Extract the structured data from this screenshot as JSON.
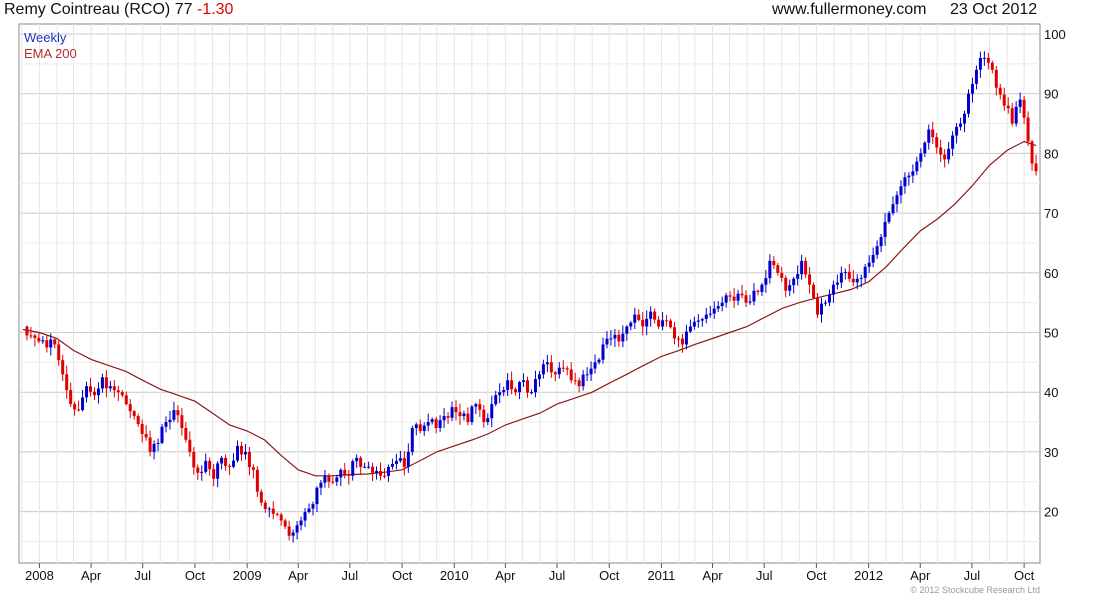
{
  "header": {
    "company": "Remy Cointreau (RCO)",
    "price": "77",
    "change": "-1.30",
    "site": "www.fullermoney.com",
    "date": "23 Oct 2012"
  },
  "legend": [
    "Weekly",
    "EMA 200"
  ],
  "footer": "© 2012 Stockcube Research Ltd",
  "colors": {
    "up": "#0000cc",
    "down": "#e00000",
    "ema": "#8b1a1a",
    "grid": "#c8c8c8",
    "legend_weekly": "#2233bb",
    "legend_ema": "#b03030"
  },
  "chart_data": {
    "type": "candlestick",
    "x_ticks": [
      "2008",
      "Apr",
      "Jul",
      "Oct",
      "2009",
      "Apr",
      "Jul",
      "Oct",
      "2010",
      "Apr",
      "Jul",
      "Oct",
      "2011",
      "Apr",
      "Jul",
      "Oct",
      "2012",
      "Apr",
      "Jul",
      "Oct"
    ],
    "y_ticks": [
      20,
      30,
      40,
      50,
      60,
      70,
      80,
      90,
      100
    ],
    "ylim": [
      14,
      101
    ],
    "close_series": [
      [
        "2007-12-03",
        51
      ],
      [
        "2007-12-17",
        49.5
      ],
      [
        "2007-12-31",
        48.5
      ],
      [
        "2008-01-14",
        47.5
      ],
      [
        "2008-01-28",
        48
      ],
      [
        "2008-02-11",
        43
      ],
      [
        "2008-02-25",
        38
      ],
      [
        "2008-03-10",
        37
      ],
      [
        "2008-03-24",
        41
      ],
      [
        "2008-04-07",
        39.5
      ],
      [
        "2008-04-21",
        42.5
      ],
      [
        "2008-05-05",
        41
      ],
      [
        "2008-05-19",
        40
      ],
      [
        "2008-06-02",
        38
      ],
      [
        "2008-06-16",
        36
      ],
      [
        "2008-06-30",
        33
      ],
      [
        "2008-07-14",
        30
      ],
      [
        "2008-07-28",
        31.5
      ],
      [
        "2008-08-11",
        35
      ],
      [
        "2008-08-25",
        37
      ],
      [
        "2008-09-08",
        34
      ],
      [
        "2008-09-22",
        30
      ],
      [
        "2008-10-06",
        26.5
      ],
      [
        "2008-10-20",
        28.5
      ],
      [
        "2008-11-03",
        25.5
      ],
      [
        "2008-11-17",
        29
      ],
      [
        "2008-12-01",
        27.5
      ],
      [
        "2008-12-15",
        31
      ],
      [
        "2008-12-29",
        30
      ],
      [
        "2009-01-12",
        27
      ],
      [
        "2009-01-26",
        21.5
      ],
      [
        "2009-02-09",
        20.5
      ],
      [
        "2009-02-23",
        19.5
      ],
      [
        "2009-03-09",
        17.5
      ],
      [
        "2009-03-23",
        16.5
      ],
      [
        "2009-04-06",
        18.5
      ],
      [
        "2009-04-20",
        20.5
      ],
      [
        "2009-05-04",
        24
      ],
      [
        "2009-05-18",
        26
      ],
      [
        "2009-06-01",
        25
      ],
      [
        "2009-06-15",
        27
      ],
      [
        "2009-06-29",
        26
      ],
      [
        "2009-07-13",
        29
      ],
      [
        "2009-07-27",
        27.5
      ],
      [
        "2009-08-10",
        26.5
      ],
      [
        "2009-08-24",
        26
      ],
      [
        "2009-09-07",
        27.5
      ],
      [
        "2009-09-21",
        28.5
      ],
      [
        "2009-10-05",
        27.5
      ],
      [
        "2009-10-19",
        34
      ],
      [
        "2009-11-02",
        33.5
      ],
      [
        "2009-11-16",
        35
      ],
      [
        "2009-11-30",
        34
      ],
      [
        "2009-12-14",
        36
      ],
      [
        "2009-12-28",
        37.5
      ],
      [
        "2010-01-11",
        36
      ],
      [
        "2010-01-25",
        35
      ],
      [
        "2010-02-08",
        38
      ],
      [
        "2010-02-22",
        35
      ],
      [
        "2010-03-08",
        38
      ],
      [
        "2010-03-22",
        40
      ],
      [
        "2010-04-05",
        42
      ],
      [
        "2010-04-19",
        40
      ],
      [
        "2010-05-03",
        42
      ],
      [
        "2010-05-17",
        40
      ],
      [
        "2010-05-31",
        43
      ],
      [
        "2010-06-14",
        45
      ],
      [
        "2010-06-28",
        43
      ],
      [
        "2010-07-12",
        44
      ],
      [
        "2010-07-26",
        42
      ],
      [
        "2010-08-09",
        41
      ],
      [
        "2010-08-23",
        43
      ],
      [
        "2010-09-06",
        45
      ],
      [
        "2010-09-20",
        48
      ],
      [
        "2010-10-04",
        49
      ],
      [
        "2010-10-18",
        48.5
      ],
      [
        "2010-11-01",
        51
      ],
      [
        "2010-11-15",
        53
      ],
      [
        "2010-11-29",
        51
      ],
      [
        "2010-12-13",
        53.5
      ],
      [
        "2010-12-27",
        51
      ],
      [
        "2011-01-10",
        52
      ],
      [
        "2011-01-24",
        49
      ],
      [
        "2011-02-07",
        48
      ],
      [
        "2011-02-21",
        51
      ],
      [
        "2011-03-07",
        52
      ],
      [
        "2011-03-21",
        53
      ],
      [
        "2011-04-04",
        54
      ],
      [
        "2011-04-18",
        55
      ],
      [
        "2011-05-02",
        56
      ],
      [
        "2011-05-16",
        56.5
      ],
      [
        "2011-05-30",
        55
      ],
      [
        "2011-06-13",
        57
      ],
      [
        "2011-06-27",
        58
      ],
      [
        "2011-07-11",
        62
      ],
      [
        "2011-07-25",
        60
      ],
      [
        "2011-08-08",
        57
      ],
      [
        "2011-08-22",
        59
      ],
      [
        "2011-09-05",
        62
      ],
      [
        "2011-09-19",
        58
      ],
      [
        "2011-10-03",
        53
      ],
      [
        "2011-10-17",
        55
      ],
      [
        "2011-10-31",
        58
      ],
      [
        "2011-11-14",
        60
      ],
      [
        "2011-11-28",
        59
      ],
      [
        "2011-12-12",
        59
      ],
      [
        "2011-12-26",
        61
      ],
      [
        "2012-01-09",
        63
      ],
      [
        "2012-01-23",
        66
      ],
      [
        "2012-02-06",
        70
      ],
      [
        "2012-02-20",
        73
      ],
      [
        "2012-03-05",
        76
      ],
      [
        "2012-03-19",
        77
      ],
      [
        "2012-04-02",
        80
      ],
      [
        "2012-04-16",
        84
      ],
      [
        "2012-04-30",
        81
      ],
      [
        "2012-05-14",
        79
      ],
      [
        "2012-05-28",
        83
      ],
      [
        "2012-06-11",
        85
      ],
      [
        "2012-06-25",
        90
      ],
      [
        "2012-07-09",
        94
      ],
      [
        "2012-07-23",
        96
      ],
      [
        "2012-08-06",
        94
      ],
      [
        "2012-08-13",
        91
      ],
      [
        "2012-08-27",
        88
      ],
      [
        "2012-09-10",
        85
      ],
      [
        "2012-09-24",
        89
      ],
      [
        "2012-10-01",
        86
      ],
      [
        "2012-10-08",
        82
      ],
      [
        "2012-10-15",
        78.3
      ],
      [
        "2012-10-22",
        77
      ]
    ],
    "ema_series": [
      [
        "2007-12-03",
        50.5
      ],
      [
        "2008-01-01",
        50
      ],
      [
        "2008-02-01",
        49
      ],
      [
        "2008-03-01",
        47
      ],
      [
        "2008-04-01",
        45.5
      ],
      [
        "2008-05-01",
        44.5
      ],
      [
        "2008-06-01",
        43.5
      ],
      [
        "2008-07-01",
        42
      ],
      [
        "2008-08-01",
        40.5
      ],
      [
        "2008-09-01",
        39.5
      ],
      [
        "2008-10-01",
        38.5
      ],
      [
        "2008-11-01",
        36.5
      ],
      [
        "2008-12-01",
        34.5
      ],
      [
        "2009-01-01",
        33.5
      ],
      [
        "2009-02-01",
        32
      ],
      [
        "2009-03-01",
        29.5
      ],
      [
        "2009-04-01",
        27
      ],
      [
        "2009-05-01",
        26
      ],
      [
        "2009-06-01",
        26
      ],
      [
        "2009-07-01",
        26.2
      ],
      [
        "2009-08-01",
        26.3
      ],
      [
        "2009-09-01",
        26.6
      ],
      [
        "2009-10-01",
        27
      ],
      [
        "2009-11-01",
        28.5
      ],
      [
        "2009-12-01",
        30
      ],
      [
        "2010-01-01",
        31
      ],
      [
        "2010-02-01",
        32
      ],
      [
        "2010-03-01",
        33
      ],
      [
        "2010-04-01",
        34.5
      ],
      [
        "2010-05-01",
        35.5
      ],
      [
        "2010-06-01",
        36.5
      ],
      [
        "2010-07-01",
        38
      ],
      [
        "2010-08-01",
        39
      ],
      [
        "2010-09-01",
        40
      ],
      [
        "2010-10-01",
        41.5
      ],
      [
        "2010-11-01",
        43
      ],
      [
        "2010-12-01",
        44.5
      ],
      [
        "2011-01-01",
        46
      ],
      [
        "2011-02-01",
        47
      ],
      [
        "2011-03-01",
        48
      ],
      [
        "2011-04-01",
        49
      ],
      [
        "2011-05-01",
        50
      ],
      [
        "2011-06-01",
        51
      ],
      [
        "2011-07-01",
        52.5
      ],
      [
        "2011-08-01",
        54
      ],
      [
        "2011-09-01",
        55
      ],
      [
        "2011-10-01",
        55.8
      ],
      [
        "2011-11-01",
        56.5
      ],
      [
        "2011-12-01",
        57.2
      ],
      [
        "2012-01-01",
        58.5
      ],
      [
        "2012-02-01",
        61
      ],
      [
        "2012-03-01",
        64
      ],
      [
        "2012-04-01",
        67
      ],
      [
        "2012-05-01",
        69
      ],
      [
        "2012-06-01",
        71.5
      ],
      [
        "2012-07-01",
        74.5
      ],
      [
        "2012-08-01",
        78
      ],
      [
        "2012-09-01",
        80.5
      ],
      [
        "2012-10-01",
        82
      ],
      [
        "2012-10-22",
        81.3
      ]
    ]
  }
}
